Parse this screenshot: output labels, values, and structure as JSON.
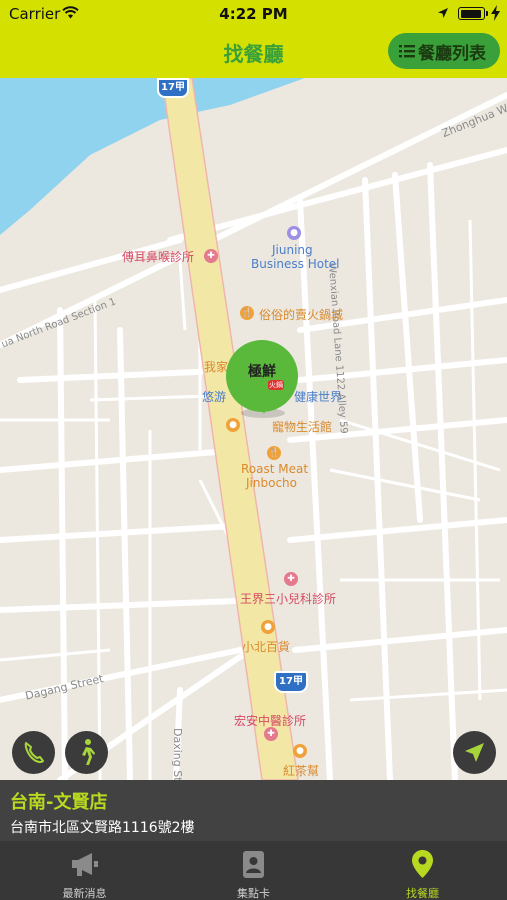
{
  "status_bar": {
    "carrier": "Carrier",
    "time": "4:22 PM"
  },
  "header": {
    "title": "找餐廳",
    "list_button_label": "餐廳列表"
  },
  "map": {
    "roads": {
      "zhonghua": "Zhonghua W",
      "wenxian_lane": "Wenxian Road Lane 1122 Alley 59",
      "north_road": "ua North Road Section 1",
      "dagang": "Dagang Street",
      "daxing": "Daxing St",
      "shield_top": "17甲",
      "shield_bottom": "17甲"
    },
    "pois": {
      "ent_clinic": "傅耳鼻喉診所",
      "hotel_line1": "Jiuning",
      "hotel_line2": "Business Hotel",
      "hotpot": "俗俗的賣火鍋城",
      "wojia": "我家",
      "health_world": "悠游",
      "health_world_tail": "健康世界",
      "pet_store": "寵物生活館",
      "roast_line1": "Roast Meat",
      "roast_line2": "Jinbocho",
      "pediatric": "王界三小兒科診所",
      "general_store": "小北百貨",
      "tcm_clinic": "宏安中醫診所",
      "tea": "紅茶幫"
    },
    "pin_logo_text": "極鮮",
    "pin_sub_text": "火鍋"
  },
  "info_panel": {
    "name": "台南-文賢店",
    "address": "台南市北區文賢路1116號2樓"
  },
  "tabs": [
    {
      "label": "最新消息",
      "icon": "megaphone-icon",
      "active": false
    },
    {
      "label": "集點卡",
      "icon": "member-card-icon",
      "active": false
    },
    {
      "label": "找餐廳",
      "icon": "map-pin-icon",
      "active": true
    }
  ],
  "colors": {
    "header": "#d3e000",
    "accent_green": "#3aa13a",
    "pin_green": "#5ab83a",
    "tab_active": "#b7d91f"
  }
}
